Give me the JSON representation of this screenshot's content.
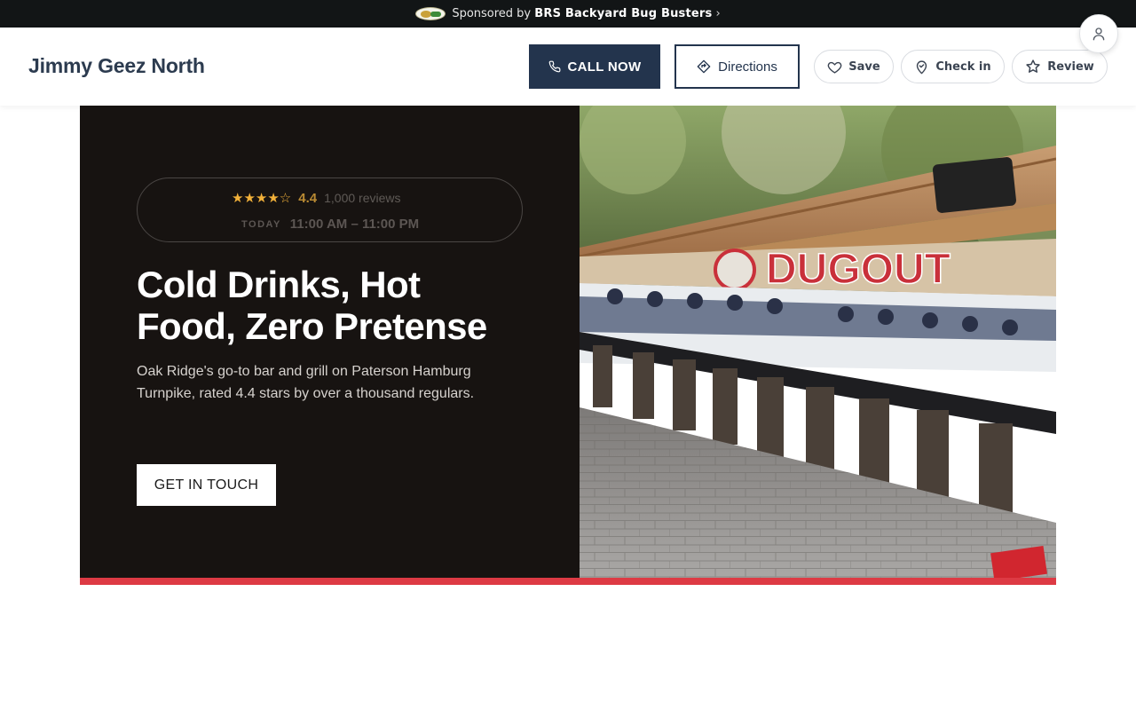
{
  "sponsor": {
    "prefix": "Sponsored by",
    "name": "BRS Backyard Bug Busters",
    "chevron": "›"
  },
  "header": {
    "brand": "Jimmy Geez North",
    "call_label": "CALL NOW",
    "directions_label": "Directions",
    "save_label": "Save",
    "checkin_label": "Check in",
    "review_label": "Review"
  },
  "hero": {
    "stars": "★★★★☆",
    "rating_value": "4.4",
    "review_count": "1,000 reviews",
    "hours_label": "TODAY",
    "hours_value": "11:00 AM – 11:00 PM",
    "headline": "Cold Drinks, Hot Food, Zero Pretense",
    "subtext": "Oak Ridge's go-to bar and grill on Paterson Hamburg Turnpike, rated 4.4 stars by over a thousand regulars.",
    "cta_label": "GET IN TOUCH",
    "accent_color": "#dd3a44",
    "image_sign_text": "DUGOUT"
  },
  "colors": {
    "navy": "#23344d",
    "hero_bg": "#171311",
    "star": "#f2b13a"
  },
  "icons": {
    "call": "phone-icon",
    "directions": "directions-icon",
    "save": "heart-icon",
    "checkin": "map-pin-icon",
    "review": "star-icon",
    "avatar": "user-icon"
  }
}
